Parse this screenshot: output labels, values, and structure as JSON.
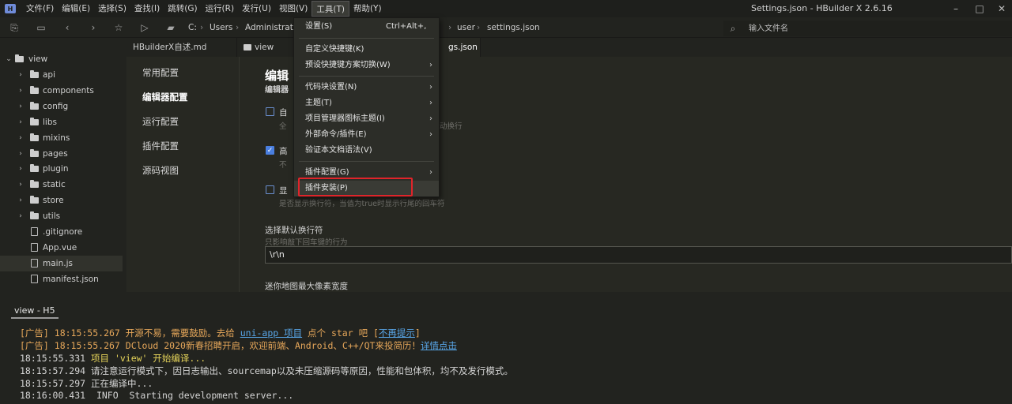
{
  "menubar": {
    "items": [
      "文件(F)",
      "编辑(E)",
      "选择(S)",
      "查找(I)",
      "跳转(G)",
      "运行(R)",
      "发行(U)",
      "视图(V)",
      "工具(T)",
      "帮助(Y)"
    ],
    "window_title": "Settings.json - HBuilder X 2.6.16"
  },
  "toolbar": {
    "breadcrumb": [
      "C:",
      "Users",
      "Administrat",
      "user",
      "settings.json"
    ],
    "file_search_placeholder": "输入文件名"
  },
  "sidebar": {
    "root": "view",
    "items": [
      {
        "label": "api",
        "type": "folder"
      },
      {
        "label": "components",
        "type": "folder"
      },
      {
        "label": "config",
        "type": "folder"
      },
      {
        "label": "libs",
        "type": "folder"
      },
      {
        "label": "mixins",
        "type": "folder"
      },
      {
        "label": "pages",
        "type": "folder"
      },
      {
        "label": "plugin",
        "type": "folder"
      },
      {
        "label": "static",
        "type": "folder"
      },
      {
        "label": "store",
        "type": "folder"
      },
      {
        "label": "utils",
        "type": "folder"
      },
      {
        "label": ".gitignore",
        "type": "file"
      },
      {
        "label": "App.vue",
        "type": "file"
      },
      {
        "label": "main.js",
        "type": "file"
      },
      {
        "label": "manifest.json",
        "type": "file"
      }
    ]
  },
  "tabs": [
    {
      "label": "HBuilderX自述.md"
    },
    {
      "label": "view"
    },
    {
      "label": "gs.json"
    }
  ],
  "settings": {
    "nav": [
      "常用配置",
      "编辑器配置",
      "运行配置",
      "插件配置",
      "源码视图"
    ],
    "title": "编辑",
    "subtitle": "编辑器",
    "row1_label": "自",
    "row1_hint_prefix": "全",
    "row1_hint_suffix": "动换行",
    "row2_label": "高",
    "row2_hint": "不",
    "row3_label": "显",
    "row3_hint": "是否显示换行符，当值为true时显示行尾的回车符",
    "newline_title": "选择默认换行符",
    "newline_hint": "只影响敲下回车键的行为",
    "newline_value": "\\r\\n",
    "minimap_title": "迷你地图最大像素宽度"
  },
  "tools_menu": {
    "items": [
      {
        "label": "设置(S)",
        "shortcut": "Ctrl+Alt+,",
        "submenu": false
      },
      {
        "label": "自定义快捷键(K)",
        "submenu": false
      },
      {
        "label": "预设快捷键方案切换(W)",
        "submenu": true
      },
      {
        "label": "代码块设置(N)",
        "submenu": true
      },
      {
        "label": "主题(T)",
        "submenu": true
      },
      {
        "label": "项目管理器图标主题(I)",
        "submenu": true
      },
      {
        "label": "外部命令/插件(E)",
        "submenu": true
      },
      {
        "label": "验证本文档语法(V)",
        "submenu": false
      },
      {
        "label": "插件配置(G)",
        "submenu": true
      },
      {
        "label": "插件安装(P)",
        "submenu": false
      }
    ]
  },
  "console": {
    "title": "view - H5",
    "lines": [
      {
        "prefix": "[广告] 18:15:55.267 ",
        "text": "开源不易，需要鼓励。去给 ",
        "link": "uni-app 项目",
        "after": " 点个 star 吧 [",
        "link2": "不再提示",
        "end": "]"
      },
      {
        "prefix": "[广告] 18:15:55.267 ",
        "text": "DCloud 2020新春招聘开启，欢迎前端、Android、C++/QT来投简历！",
        "link": "详情点击"
      },
      {
        "time": "18:15:55.331 ",
        "text": "项目 'view' 开始编译..."
      },
      {
        "time": "18:15:57.294 ",
        "text": "请注意运行模式下，因日志输出、sourcemap以及未压缩源码等原因，性能和包体积，均不及发行模式。"
      },
      {
        "time": "18:15:57.297 ",
        "text": "正在编译中..."
      },
      {
        "time": "18:16:00.431 ",
        "text": " INFO  Starting development server..."
      }
    ]
  }
}
